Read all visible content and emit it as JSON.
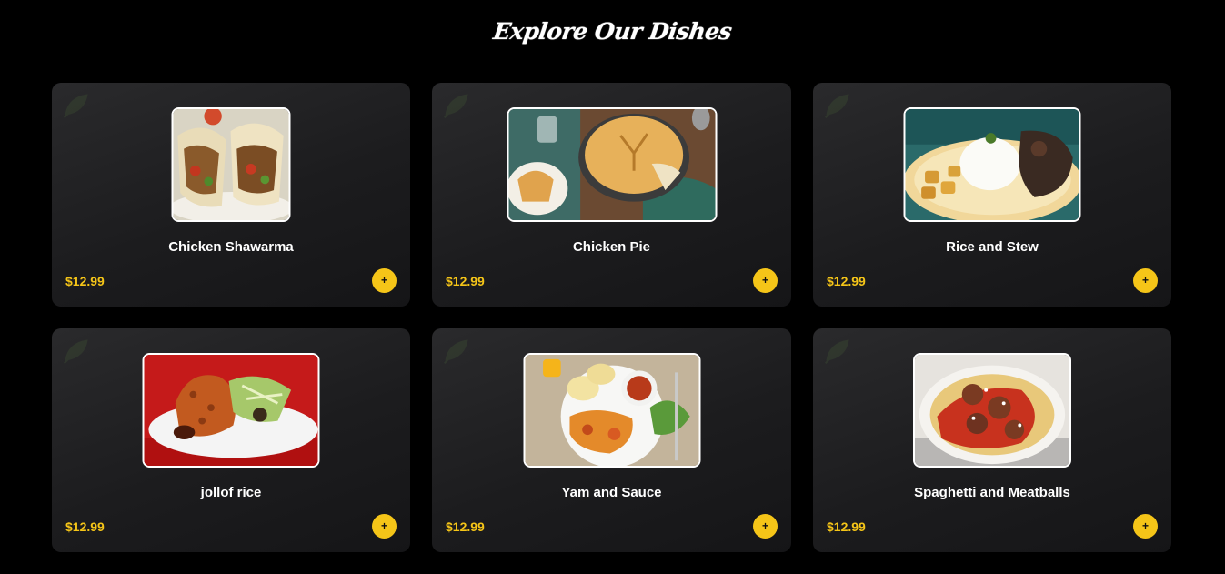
{
  "section": {
    "title": "Explore Our Dishes"
  },
  "colors": {
    "background": "#000000",
    "card": "#1f1f21",
    "accent": "#f5c518",
    "text": "#ffffff"
  },
  "dishes": [
    {
      "name": "Chicken Shawarma",
      "price": "$12.99",
      "add_label": "+",
      "image": "chicken-shawarma-photo"
    },
    {
      "name": "Chicken Pie",
      "price": "$12.99",
      "add_label": "+",
      "image": "chicken-pie-photo"
    },
    {
      "name": "Rice and Stew",
      "price": "$12.99",
      "add_label": "+",
      "image": "rice-and-stew-photo"
    },
    {
      "name": "jollof rice",
      "price": "$12.99",
      "add_label": "+",
      "image": "jollof-rice-photo"
    },
    {
      "name": "Yam and Sauce",
      "price": "$12.99",
      "add_label": "+",
      "image": "yam-and-sauce-photo"
    },
    {
      "name": "Spaghetti and Meatballs",
      "price": "$12.99",
      "add_label": "+",
      "image": "spaghetti-and-meatballs-photo"
    }
  ]
}
